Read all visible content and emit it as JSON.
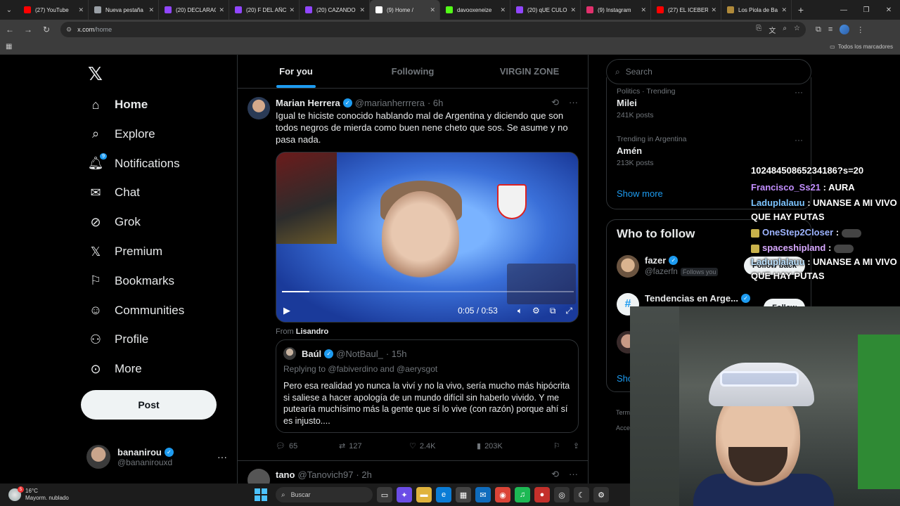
{
  "browser": {
    "tabs": [
      {
        "title": "(27) YouTube",
        "color": "#ff0000"
      },
      {
        "title": "Nueva pestaña",
        "color": "#9aa0a6"
      },
      {
        "title": "(20) DECLARAC",
        "color": "#9146ff"
      },
      {
        "title": "(20) F DEL AÑC",
        "color": "#9146ff"
      },
      {
        "title": "(20) CAZANDO",
        "color": "#9146ff"
      },
      {
        "title": "(9) Home /",
        "color": "#ffffff"
      },
      {
        "title": "davooxeneize",
        "color": "#53fc18"
      },
      {
        "title": "(20) qUE CULO",
        "color": "#9146ff"
      },
      {
        "title": "(9) Instagram",
        "color": "#e1306c"
      },
      {
        "title": "(27) EL ICEBER",
        "color": "#ff0000"
      },
      {
        "title": "Los Piola de Ba",
        "color": "#b08a3a"
      }
    ],
    "url_host": "x.com",
    "url_path": "/home",
    "all_bookmarks": "Todos los marcadores"
  },
  "nav": {
    "items": [
      {
        "label": "Home",
        "icon": "home-icon",
        "active": true
      },
      {
        "label": "Explore",
        "icon": "search-icon"
      },
      {
        "label": "Notifications",
        "icon": "bell-icon",
        "badge": "9"
      },
      {
        "label": "Chat",
        "icon": "mail-icon"
      },
      {
        "label": "Grok",
        "icon": "grok-icon"
      },
      {
        "label": "Premium",
        "icon": "x-icon"
      },
      {
        "label": "Bookmarks",
        "icon": "bookmark-icon"
      },
      {
        "label": "Communities",
        "icon": "people-icon"
      },
      {
        "label": "Profile",
        "icon": "person-icon"
      },
      {
        "label": "More",
        "icon": "more-icon"
      }
    ],
    "post_label": "Post",
    "me": {
      "name": "bananirou",
      "handle": "@bananirouxd"
    }
  },
  "timeline": {
    "tabs": [
      "For you",
      "Following",
      "VIRGIN ZONE"
    ],
    "tweet": {
      "name": "Marian Herrera",
      "handle": "@marianherrrera",
      "time": "· 6h",
      "text": "Igual te hiciste conocido hablando mal de Argentina y diciendo que son todos negros de mierda como buen nene cheto que sos. Se asume y no pasa nada.",
      "video": {
        "time": "0:05 / 0:53",
        "progress": 0.094
      },
      "from_label": "From",
      "from_user": "Lisandro",
      "quote": {
        "name": "Baúl",
        "handle": "@NotBaul_",
        "time": "· 15h",
        "reply_prefix": "Replying to",
        "reply_user1": "@fabiverdino",
        "reply_and": "and",
        "reply_user2": "@aerysgot",
        "text": "Pero esa realidad yo nunca la viví y no la vivo, sería mucho más hipócrita si saliese a hacer apología de un mundo difícil sin haberlo vivido. Y me putearía muchísimo más la gente que sí lo vive (con razón) porque ahí sí es injusto...."
      },
      "replies": "65",
      "reposts": "127",
      "likes": "2.4K",
      "views": "203K"
    },
    "tweet2": {
      "name": "tano",
      "handle": "@Tanovich97",
      "time": "· 2h"
    }
  },
  "right": {
    "search_placeholder": "Search",
    "trends": [
      {
        "category": "Politics · Trending",
        "name": "Milei",
        "count": "241K posts"
      },
      {
        "category": "Trending in Argentina",
        "name": "Amén",
        "count": "213K posts"
      }
    ],
    "show_more": "Show more",
    "who_to_follow": "Who to follow",
    "follow_rows": [
      {
        "name": "fazer",
        "handle": "@fazerfn",
        "follows_you": "Follows you",
        "button": "Follow back"
      },
      {
        "name": "Tendencias en Arge...",
        "handle": "",
        "button": "Follow"
      }
    ],
    "show_short": "Sho",
    "footer1": "Term",
    "footer2": "Acce"
  },
  "chat": [
    {
      "user": "",
      "msg": "10248450865234186?s=20"
    },
    {
      "user": "Francisco_Ss21",
      "msg": ": AURA"
    },
    {
      "user": "Laduplalauu",
      "msg": ": UNANSE A MI VIVO QUE HAY PUTAS"
    },
    {
      "user": "OneStep2Closer",
      "msg": ":"
    },
    {
      "user": "spaceshipland",
      "msg": ":"
    },
    {
      "user": "Laduplalauu",
      "msg": ": UNANSE A MI VIVO QUE HAY PUTAS"
    }
  ],
  "taskbar": {
    "temp": "16°C",
    "weather": "Mayorm. nublado",
    "weather_badge": "5",
    "search": "Buscar"
  }
}
